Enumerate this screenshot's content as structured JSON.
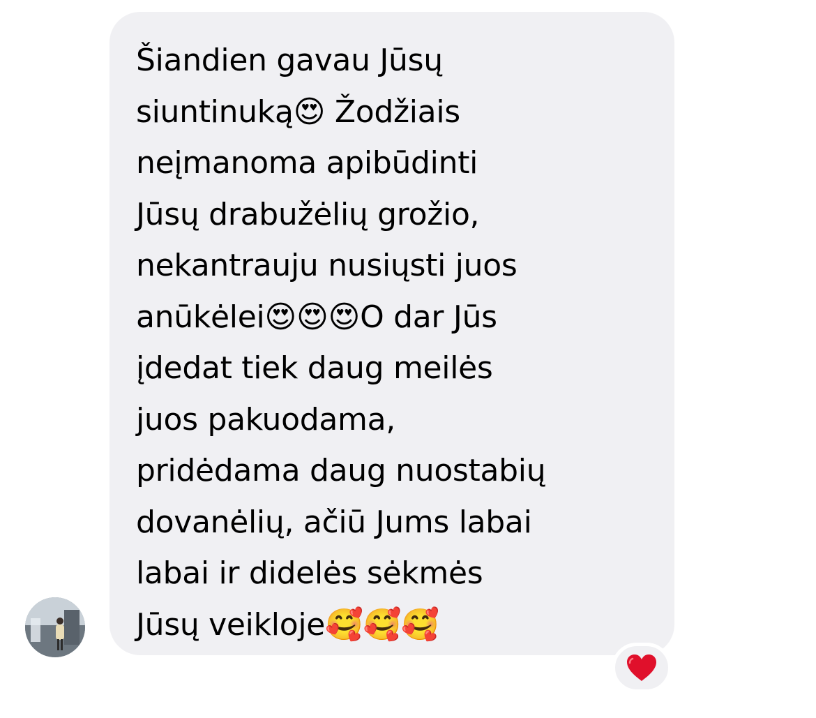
{
  "conversation": {
    "sender_avatar_icon": "user-avatar-photo",
    "message": {
      "lines": [
        "Šiandien gavau Jūsų",
        "siuntinuką😍 Žodžiais",
        "neįmanoma apibūdinti",
        "Jūsų drabužėlių grožio,",
        "nekantrauju nusiųsti juos",
        "anūkėlei😍😍😍O dar Jūs",
        "įdedat tiek daug meilės",
        "juos pakuodama,",
        "pridėdama daug nuostabių",
        "dovanėlių, ačiū Jums labai",
        "labai ir didelės sėkmės",
        "Jūsų veikloje🥰🥰🥰"
      ]
    },
    "reaction": {
      "icon": "red-heart-icon",
      "color": "#e0102b"
    },
    "colors": {
      "bubble": "#f0f0f3",
      "text": "#000000",
      "background": "#ffffff"
    }
  }
}
